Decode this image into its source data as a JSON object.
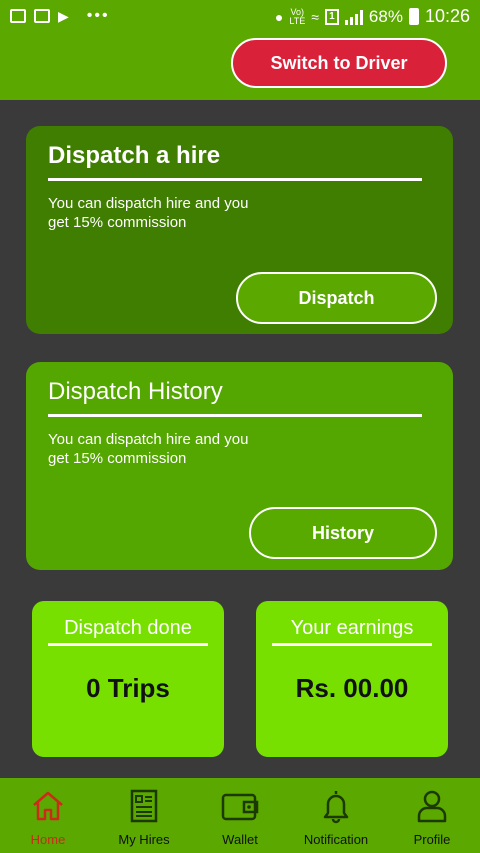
{
  "status_bar": {
    "volte": "Vo)",
    "lte": "LTE",
    "sim": "1",
    "battery": "68%",
    "time": "10:26"
  },
  "header": {
    "switch_button": "Switch to Driver"
  },
  "dispatch_card": {
    "title": "Dispatch a hire",
    "text": "You can dispatch hire and you get 15% commission",
    "button": "Dispatch"
  },
  "history_card": {
    "title": "Dispatch History",
    "text": "You can dispatch hire and you get 15% commission",
    "button": "History"
  },
  "stats": {
    "dispatch_done_label": "Dispatch done",
    "dispatch_done_value": "0 Trips",
    "earnings_label": "Your earnings",
    "earnings_value": "Rs. 00.00"
  },
  "bottom_nav": [
    {
      "label": "Home",
      "icon": "home-icon",
      "active": true
    },
    {
      "label": "My Hires",
      "icon": "document-icon",
      "active": false
    },
    {
      "label": "Wallet",
      "icon": "wallet-icon",
      "active": false
    },
    {
      "label": "Notification",
      "icon": "bell-icon",
      "active": false
    },
    {
      "label": "Profile",
      "icon": "user-icon",
      "active": false
    }
  ],
  "colors": {
    "primary_green": "#5aa800",
    "dark_card": "#3f7e00",
    "light_tile": "#77e000",
    "switch_red": "#d9213a",
    "active_nav": "#cc2a1a",
    "background": "#3a3a3a"
  }
}
